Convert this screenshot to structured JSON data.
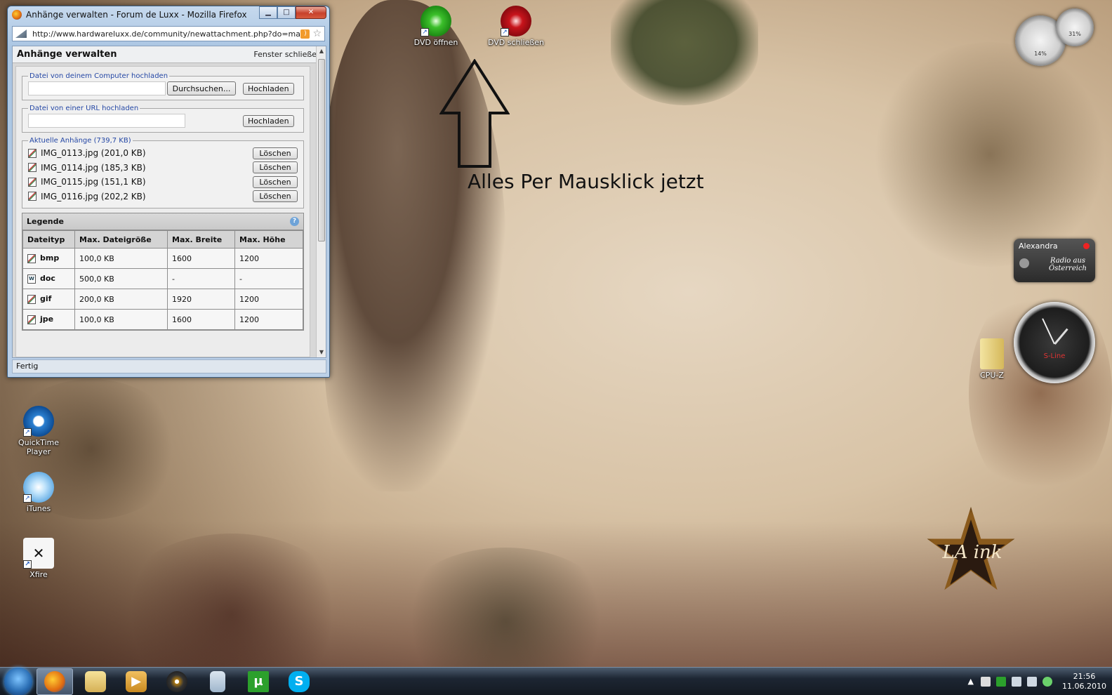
{
  "browser": {
    "window_title": "Anhänge verwalten - Forum de Luxx - Mozilla Firefox",
    "url": "http://www.hardwareluxx.de/community/newattachment.php?do=manag",
    "btn_minimize": "▁",
    "btn_maximize": "□",
    "btn_close": "✕",
    "status": "Fertig"
  },
  "page": {
    "title": "Anhänge verwalten",
    "close_window": "Fenster schließen",
    "upload_computer": {
      "legend": "Datei von deinem Computer hochladen",
      "browse_label": "Durchsuchen...",
      "upload_label": "Hochladen"
    },
    "upload_url": {
      "legend": "Datei von einer URL hochladen",
      "upload_label": "Hochladen"
    },
    "attachments": {
      "legend": "Aktuelle Anhänge (739,7 KB)",
      "delete_label": "Löschen",
      "items": [
        {
          "name": "IMG_0113.jpg (201,0 KB)"
        },
        {
          "name": "IMG_0114.jpg (185,3 KB)"
        },
        {
          "name": "IMG_0115.jpg (151,1 KB)"
        },
        {
          "name": "IMG_0116.jpg (202,2 KB)"
        }
      ]
    },
    "legend_table": {
      "title": "Legende",
      "headers": [
        "Dateityp",
        "Max. Dateigröße",
        "Max. Breite",
        "Max. Höhe"
      ],
      "rows": [
        {
          "type": "bmp",
          "size": "100,0 KB",
          "width": "1600",
          "height": "1200"
        },
        {
          "type": "doc",
          "size": "500,0 KB",
          "width": "-",
          "height": "-"
        },
        {
          "type": "gif",
          "size": "200,0 KB",
          "width": "1920",
          "height": "1200"
        },
        {
          "type": "jpe",
          "size": "100,0 KB",
          "width": "1600",
          "height": "1200"
        }
      ]
    }
  },
  "desktop": {
    "icons": [
      {
        "label": "DVD öffnen",
        "color": "#3bbf2a"
      },
      {
        "label": "DVD schließen",
        "color": "#c8141b"
      },
      {
        "label": "QuickTime Player",
        "color": "#2a7fd0"
      },
      {
        "label": "iTunes",
        "color": "#6ab0e6"
      },
      {
        "label": "Xfire",
        "color": "#ffffff"
      },
      {
        "label": "CPU-Z",
        "color": "#e8d27a"
      }
    ],
    "annotation": "Alles Per Mausklick jetzt",
    "gauge_cpu": "14%",
    "gauge_mem": "31%",
    "radio_station": "Alexandra",
    "radio_logo": "Radio aus Österreich",
    "clock_brand": "S-Line",
    "star_logo": "LA ink"
  },
  "taskbar": {
    "apps": [
      {
        "name": "firefox-icon",
        "color": "#e06a10",
        "glyph": ""
      },
      {
        "name": "explorer-icon",
        "color": "#e7c65a",
        "glyph": ""
      },
      {
        "name": "media-player-icon",
        "color": "#d9a23a",
        "glyph": "▶"
      },
      {
        "name": "app-icon",
        "color": "#333333",
        "glyph": "●"
      },
      {
        "name": "calculator-icon",
        "color": "#9fb6cc",
        "glyph": ""
      },
      {
        "name": "utorrent-icon",
        "color": "#2ca02c",
        "glyph": "µ"
      },
      {
        "name": "skype-icon",
        "color": "#00aff0",
        "glyph": "S"
      }
    ],
    "time": "21:56",
    "date": "11.06.2010"
  }
}
